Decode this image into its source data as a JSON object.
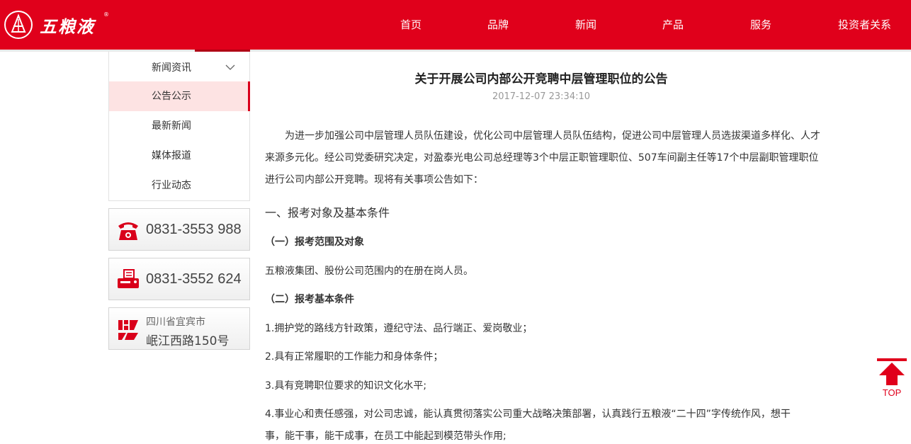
{
  "header": {
    "logo_text": "五粮液",
    "logo_reg": "®",
    "nav": [
      "首页",
      "品牌",
      "新闻",
      "产品",
      "服务",
      "投资者关系"
    ]
  },
  "sidebar": {
    "items": [
      {
        "label": "新闻资讯",
        "expandable": true
      },
      {
        "label": "公告公示",
        "active": true
      },
      {
        "label": "最新新闻"
      },
      {
        "label": "媒体报道"
      },
      {
        "label": "行业动态"
      }
    ],
    "phone": "0831-3553 988",
    "fax": "0831-3552 624",
    "address_line1": "四川省宜宾市",
    "address_line2": "岷江西路150号"
  },
  "article": {
    "title": "关于开展公司内部公开竞聘中层管理职位的公告",
    "date": "2017-12-07 23:34:10",
    "intro": "为进一步加强公司中层管理人员队伍建设，优化公司中层管理人员队伍结构，促进公司中层管理人员选拔渠道多样化、人才来源多元化。经公司党委研究决定，对盈泰光电公司总经理等3个中层正职管理职位、507车间副主任等17个中层副职管理职位进行公司内部公开竞聘。现将有关事项公告如下：",
    "section1": "一、报考对象及基本条件",
    "sub1": "（一）报考范围及对象",
    "scope": "五粮液集团、股份公司范围内的在册在岗人员。",
    "sub2": "（二）报考基本条件",
    "cond1": "1.拥护党的路线方针政策，遵纪守法、品行端正、爱岗敬业；",
    "cond2": "2.具有正常履职的工作能力和身体条件；",
    "cond3": "3.具有竞聘职位要求的知识文化水平;",
    "cond4a": "4.事业心和责任感强，对公司忠诚，能认真贯彻落实公司重大战略决策部署，认真践行五粮液“二十四”字传统作风，想干",
    "cond4b": "事，能干事，能干成事，在员工中能起到模范带头作用;"
  },
  "top_button": {
    "label": "TOP"
  },
  "colors": {
    "brand_red": "#e0001b",
    "active_bg": "#fde3e3"
  }
}
